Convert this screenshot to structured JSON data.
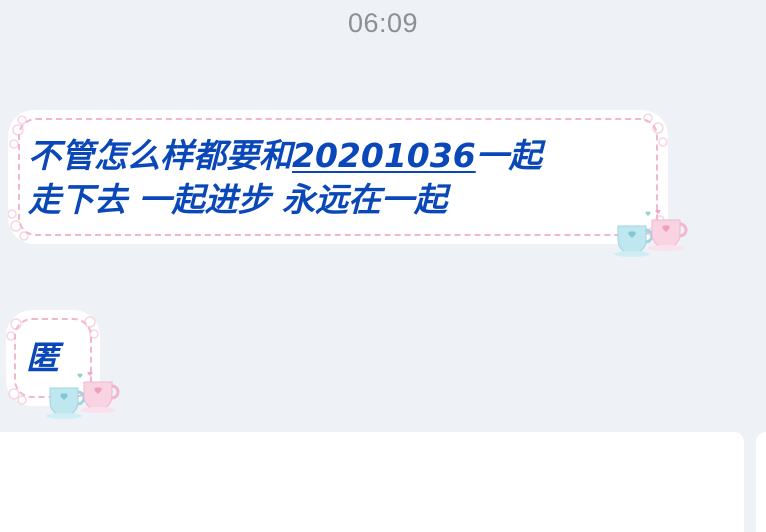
{
  "chat": {
    "timestamp": "06:09",
    "messages": [
      {
        "line1_prefix": "不管怎么样都要和",
        "line1_link": "20201036",
        "line1_suffix": "一起",
        "line2": "走下去 一起进步 永远在一起"
      },
      {
        "text": "匿"
      }
    ]
  },
  "colors": {
    "background": "#eef1f6",
    "bubble": "#ffffff",
    "bubble_border": "#f2b6cf",
    "text": "#0a47b8",
    "timestamp": "#8b8f96"
  },
  "icons": {
    "bubble_decoration": "coffee-cups-icon",
    "bubble_frame": "lace-frame"
  }
}
